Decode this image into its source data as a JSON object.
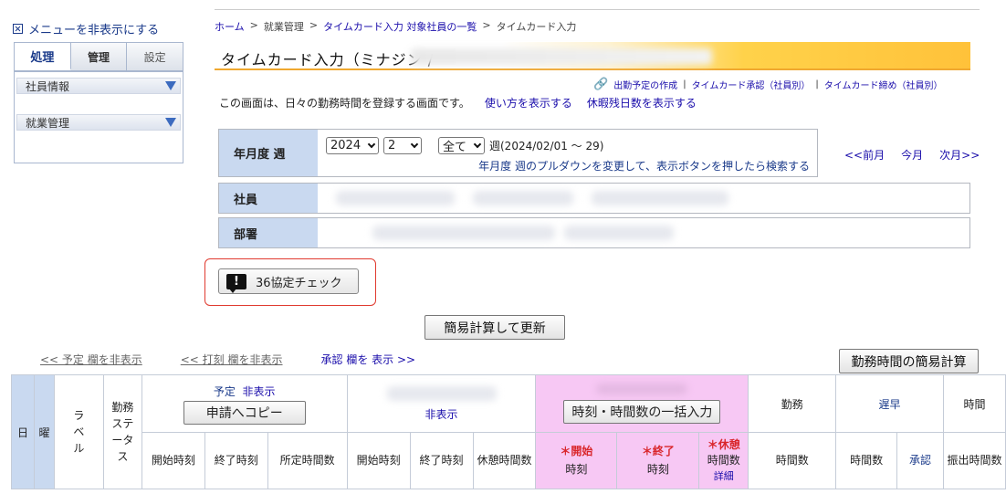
{
  "sidebar": {
    "toggle_label": "メニューを非表示にする",
    "tabs": [
      {
        "label": "処理",
        "active": true
      },
      {
        "label": "管理",
        "active": false
      },
      {
        "label": "設定",
        "active": false
      }
    ],
    "sections": [
      {
        "label": "社員情報"
      },
      {
        "label": "就業管理"
      }
    ]
  },
  "breadcrumb": {
    "home": "ホーム",
    "sep": ">",
    "management": "就業管理",
    "list": "タイムカード入力 対象社員の一覧",
    "current": "タイムカード入力"
  },
  "page": {
    "title": "タイムカード入力（ミナジン / ",
    "intro": "この画面は、日々の勤務時間を登録する画面です。",
    "howto_link": "使い方を表示する",
    "leave_link": "休暇残日数を表示する"
  },
  "quick_links": {
    "schedule": "出勤予定の作成",
    "approve": "タイムカード承認（社員別）",
    "close": "タイムカード締め（社員別）",
    "sep": "|"
  },
  "filter": {
    "week_label": "年月度 週",
    "year": "2024",
    "week": "2",
    "scope": "全て",
    "week_range": "週(2024/02/01 ～ 29)",
    "hint": "年月度 週のプルダウンを変更して、表示ボタンを押したら検索する",
    "employee_label": "社員",
    "department_label": "部署"
  },
  "month_nav": {
    "prev": "<<前月",
    "this": "今月",
    "next": "次月>>"
  },
  "check_button": {
    "label": "36協定チェック",
    "icon": "!"
  },
  "calc_button": "簡易計算して更新",
  "toggles": {
    "schedule": "<< 予定 欄を非表示",
    "stamp": "<< 打刻 欄を非表示",
    "approval": "承認 欄を 表示 >>"
  },
  "quick_calc_button": "勤務時間の簡易計算",
  "table": {
    "day": "日",
    "weekday": "曜",
    "label": "ラベル",
    "work_status": "勤務ステータス",
    "schedule_group": "予定",
    "hide_link": "非表示",
    "copy_button": "申請へコピー",
    "hide_link2": "非表示",
    "bulk_button": "時刻・時間数の一括入力",
    "work": "勤務",
    "late": "遅早",
    "time_group": "時間",
    "cols": {
      "start": "開始時刻",
      "end": "終了時刻",
      "prescribed": "所定時間数",
      "start2": "開始時刻",
      "end2": "終了時刻",
      "break": "休憩時間数",
      "req_start": "開始",
      "req_start2": "時刻",
      "req_end": "終了",
      "req_end2": "時刻",
      "req_break": "休憩",
      "req_break2": "時間数",
      "detail": "詳細",
      "work_hours": "時間数",
      "late_hours": "時間数",
      "approve": "承認",
      "transfer": "振出時間数"
    },
    "req_mark": "＊"
  },
  "colors": {
    "header_blue": "#c9d9f0",
    "pink": "#f7c8f4",
    "accent_orange": "#ffc23a",
    "alert_red": "#e03a2f"
  }
}
